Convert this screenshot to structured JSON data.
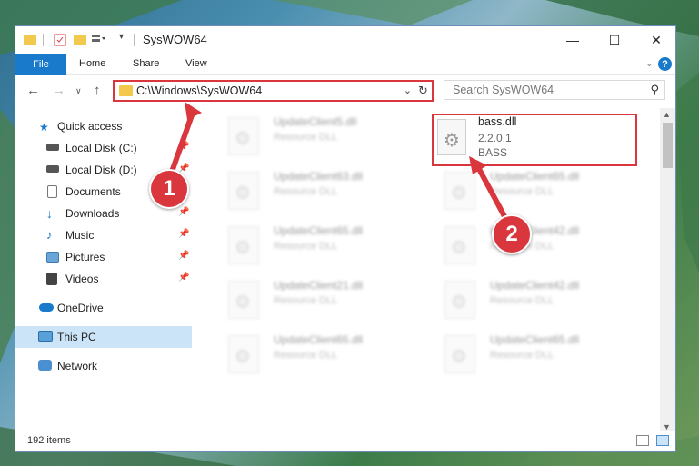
{
  "window": {
    "title": "SysWOW64",
    "controls": {
      "minimize": "—",
      "maximize": "☐",
      "close": "✕"
    }
  },
  "ribbon": {
    "tabs": [
      "File",
      "Home",
      "Share",
      "View"
    ]
  },
  "nav": {
    "address": "C:\\Windows\\SysWOW64",
    "search_placeholder": "Search SysWOW64"
  },
  "sidebar": {
    "items": [
      {
        "label": "Quick access",
        "icon": "star-icon",
        "pinned": false
      },
      {
        "label": "Local Disk (C:)",
        "icon": "drive-icon",
        "pinned": true
      },
      {
        "label": "Local Disk (D:)",
        "icon": "drive-icon",
        "pinned": true
      },
      {
        "label": "Documents",
        "icon": "documents-icon",
        "pinned": true
      },
      {
        "label": "Downloads",
        "icon": "download-icon",
        "pinned": true
      },
      {
        "label": "Music",
        "icon": "music-icon",
        "pinned": true
      },
      {
        "label": "Pictures",
        "icon": "pictures-icon",
        "pinned": true
      },
      {
        "label": "Videos",
        "icon": "videos-icon",
        "pinned": true
      },
      {
        "label": "OneDrive",
        "icon": "cloud-icon",
        "pinned": false
      },
      {
        "label": "This PC",
        "icon": "computer-icon",
        "pinned": false
      },
      {
        "label": "Network",
        "icon": "network-icon",
        "pinned": false
      }
    ]
  },
  "files": [
    {
      "name": "UpdateClient5.dll",
      "type": "Resource DLL"
    },
    {
      "name": "UpdateClient63.dll",
      "type": "Resource DLL"
    },
    {
      "name": "UpdateClient65.dll",
      "type": "Resource DLL"
    },
    {
      "name": "UpdateClient65.dll",
      "type": "Resource DLL"
    },
    {
      "name": "UpdateClient65.dll",
      "type": "Resource DLL"
    },
    {
      "name": "UpdateClient42.dll",
      "type": "Resource DLL"
    },
    {
      "name": "UpdateClient21.dll",
      "type": "Resource DLL"
    },
    {
      "name": "UpdateClient42.dll",
      "type": "Resource DLL"
    },
    {
      "name": "UpdateClient65.dll",
      "type": "Resource DLL"
    },
    {
      "name": "UpdateClient65.dll",
      "type": "Resource DLL"
    }
  ],
  "highlighted_file": {
    "name": "bass.dll",
    "version": "2.2.0.1",
    "description": "BASS"
  },
  "status": {
    "item_count": "192 items"
  },
  "annotations": {
    "step1": "1",
    "step2": "2",
    "color": "#d9363e"
  },
  "colors": {
    "accent": "#1979ca",
    "selection": "#cce4f7",
    "highlight": "#d9363e"
  }
}
